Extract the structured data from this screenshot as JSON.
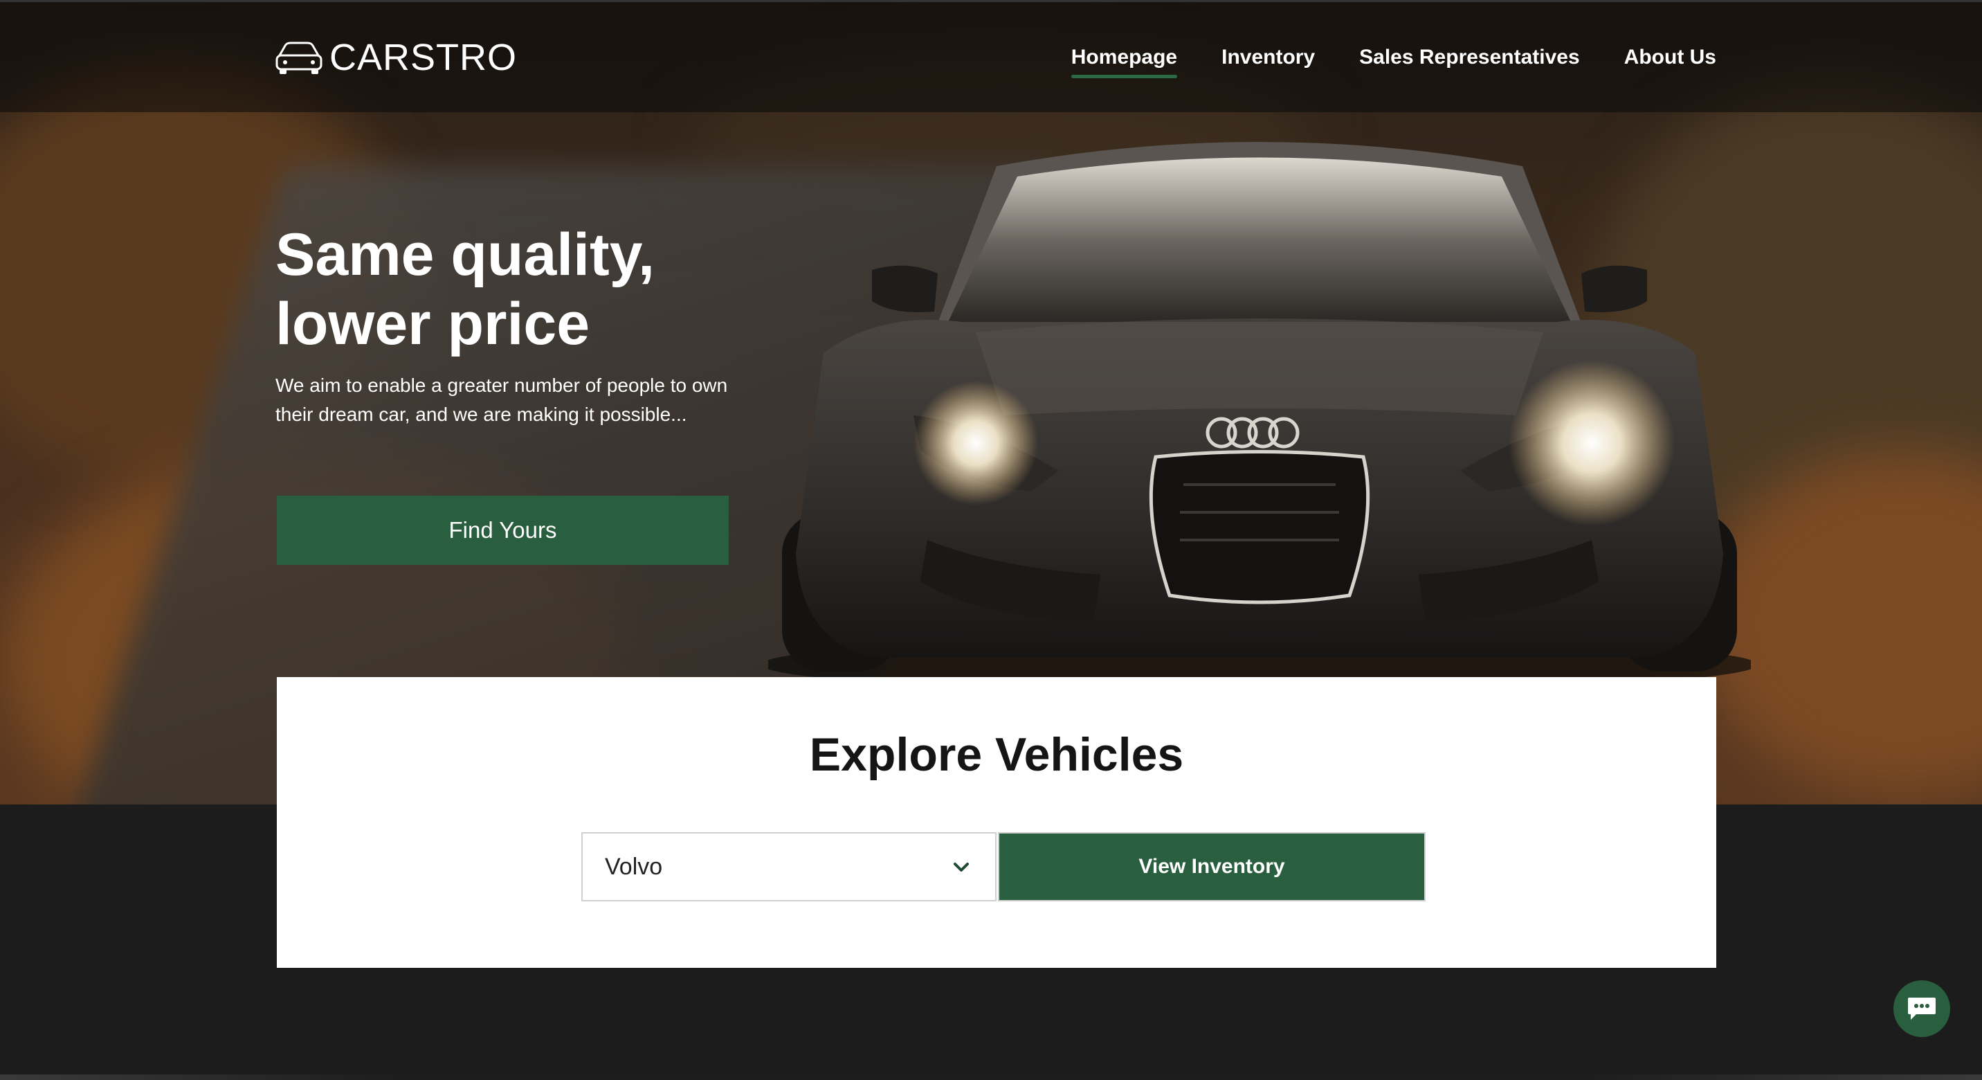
{
  "brand": {
    "name": "CARSTRO",
    "logo_icon": "car-outline-icon"
  },
  "nav": {
    "items": [
      {
        "label": "Homepage",
        "active": true
      },
      {
        "label": "Inventory",
        "active": false
      },
      {
        "label": "Sales Representatives",
        "active": false
      },
      {
        "label": "About Us",
        "active": false
      }
    ]
  },
  "hero": {
    "title_line1": "Same quality,",
    "title_line2": "lower price",
    "subtitle": "We aim to enable a greater number of people to own their dream car, and we are making it possible...",
    "cta_label": "Find Yours"
  },
  "explore": {
    "title": "Explore Vehicles",
    "selected_brand": "Volvo",
    "dropdown_icon": "chevron-down-icon",
    "button_label": "View Inventory"
  },
  "chat": {
    "icon": "chat-bubble-icon"
  },
  "colors": {
    "accent": "#295e3f",
    "footer_bg": "#1c1c1c",
    "card_bg": "#ffffff"
  }
}
